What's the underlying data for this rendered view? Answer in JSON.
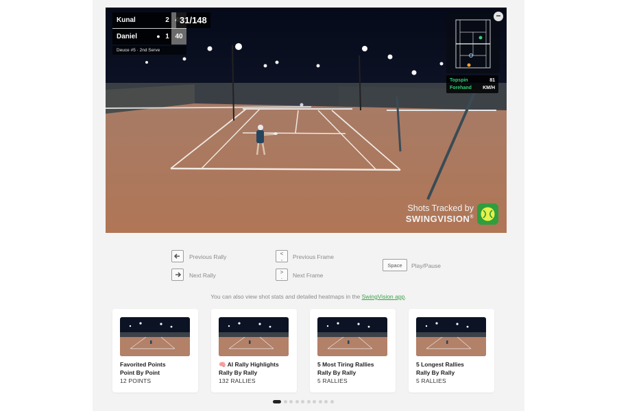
{
  "scoreboard": {
    "players": [
      {
        "name": "Kunal",
        "serving": false,
        "sets": "2",
        "game": "40"
      },
      {
        "name": "Daniel",
        "serving": true,
        "sets": "1",
        "game": "40"
      }
    ],
    "status": "Deuce #5 · 2nd Serve",
    "shot_counter": "31/148"
  },
  "shot_info": {
    "spin": "Topspin",
    "stroke": "Forehand",
    "speed": "81",
    "unit": "KM/H"
  },
  "minimap": {
    "close_glyph": "−"
  },
  "watermark": {
    "line1": "Shots Tracked by",
    "line2": "SWINGVISION",
    "reg": "®"
  },
  "shortcuts": {
    "prev_rally": {
      "key": "🡐",
      "label": "Previous Rally"
    },
    "next_rally": {
      "key": "🡒",
      "label": "Next Rally"
    },
    "prev_frame": {
      "key": "<\n,",
      "label": "Previous Frame"
    },
    "next_frame": {
      "key": ">\n.",
      "label": "Next Frame"
    },
    "play_pause": {
      "key": "Space",
      "label": "Play/Pause"
    }
  },
  "note": {
    "before": "You can also view shot stats and detailed heatmaps in the ",
    "link": "SwingVision app",
    "after": "."
  },
  "cards": [
    {
      "title": "Favorited Points",
      "subtitle": "Point By Point",
      "count": "12 POINTS",
      "emoji": ""
    },
    {
      "title": "AI Rally Highlights",
      "subtitle": "Rally By Rally",
      "count": "132 RALLIES",
      "emoji": "🧠"
    },
    {
      "title": "5 Most Tiring Rallies",
      "subtitle": "Rally By Rally",
      "count": "5 RALLIES",
      "emoji": ""
    },
    {
      "title": "5 Longest Rallies",
      "subtitle": "Rally By Rally",
      "count": "5 RALLIES",
      "emoji": ""
    }
  ],
  "pagination": {
    "total": 10,
    "active": 1
  },
  "colors": {
    "accent": "#3aa046",
    "court": "#b8826a",
    "sky": "#0a1020"
  },
  "icons": [
    "arrow-left-icon",
    "arrow-right-icon",
    "swingvision-logo-icon",
    "minimize-icon",
    "brain-icon"
  ]
}
